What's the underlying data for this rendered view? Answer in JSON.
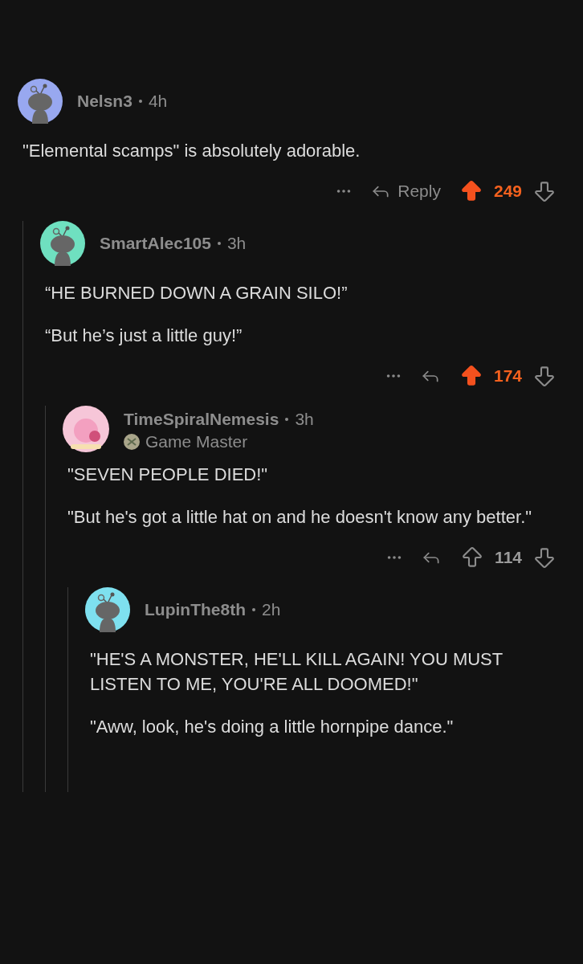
{
  "comments": [
    {
      "author": "Nelsn3",
      "time": "4h",
      "avatar": {
        "kind": "snoo",
        "color": "#98a8f0"
      },
      "paragraphs": [
        "\"Elemental scamps\" is absolutely adorable."
      ],
      "actions": {
        "reply_label": "Reply",
        "upvoted": true,
        "score": "249"
      },
      "replies": [
        {
          "author": "SmartAlec105",
          "time": "3h",
          "avatar": {
            "kind": "snoo",
            "color": "#6fe0c0"
          },
          "paragraphs": [
            "“HE BURNED DOWN A GRAIN SILO!”",
            "“But he’s just a little guy!”"
          ],
          "actions": {
            "upvoted": true,
            "score": "174"
          },
          "replies": [
            {
              "author": "TimeSpiralNemesis",
              "time": "3h",
              "flair": "Game Master",
              "avatar": {
                "kind": "custom",
                "color": "#f6c6d8"
              },
              "paragraphs": [
                "\"SEVEN PEOPLE DIED!\"",
                "\"But he's got a little hat on and he doesn't know any better.\""
              ],
              "actions": {
                "upvoted": false,
                "score": "114"
              },
              "replies": [
                {
                  "author": "LupinThe8th",
                  "time": "2h",
                  "avatar": {
                    "kind": "snoo",
                    "color": "#7ee0ef"
                  },
                  "paragraphs": [
                    "\"HE'S A MONSTER, HE'LL KILL AGAIN! YOU MUST LISTEN TO ME, YOU'RE ALL DOOMED!\"",
                    "\"Aww, look, he's doing a little hornpipe dance.\""
                  ]
                }
              ]
            }
          ]
        }
      ]
    }
  ]
}
